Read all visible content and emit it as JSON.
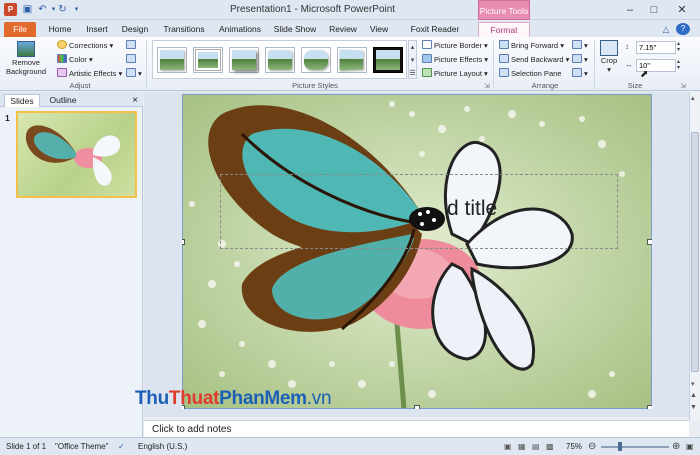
{
  "window": {
    "title": "Presentation1  -  Microsoft PowerPoint",
    "context_tab_group": "Picture Tools"
  },
  "tabs": [
    "File",
    "Home",
    "Insert",
    "Design",
    "Transitions",
    "Animations",
    "Slide Show",
    "Review",
    "View",
    "Foxit Reader PDF",
    "Format"
  ],
  "ribbon": {
    "adjust": {
      "remove_background_1": "Remove",
      "remove_background_2": "Background",
      "corrections": "Corrections",
      "color": "Color",
      "artistic_effects": "Artistic Effects",
      "label": "Adjust"
    },
    "picture_styles": {
      "label": "Picture Styles",
      "picture_border": "Picture Border",
      "picture_effects": "Picture Effects",
      "picture_layout": "Picture Layout"
    },
    "arrange": {
      "label": "Arrange",
      "bring_forward": "Bring Forward",
      "send_backward": "Send Backward",
      "selection_pane": "Selection Pane"
    },
    "size": {
      "label": "Size",
      "crop": "Crop",
      "height": "7.15\"",
      "width": "10\""
    }
  },
  "left_pane": {
    "tab_slides": "Slides",
    "tab_outline": "Outline",
    "slide_number": "1",
    "close": "×"
  },
  "slide": {
    "title_placeholder": "d title"
  },
  "notes_placeholder": "Click to add notes",
  "watermark": {
    "part1": "Thu",
    "part2": "Thuat",
    "part3": "PhanMem",
    "part4": ".vn"
  },
  "status": {
    "slide_info": "Slide 1 of 1",
    "theme": "\"Office Theme\"",
    "language": "English (U.S.)",
    "zoom": "75%"
  },
  "colors": {
    "file_tab": "#e06a2b",
    "context_tab": "#e98cb2",
    "selection_border": "#f2c04b"
  }
}
